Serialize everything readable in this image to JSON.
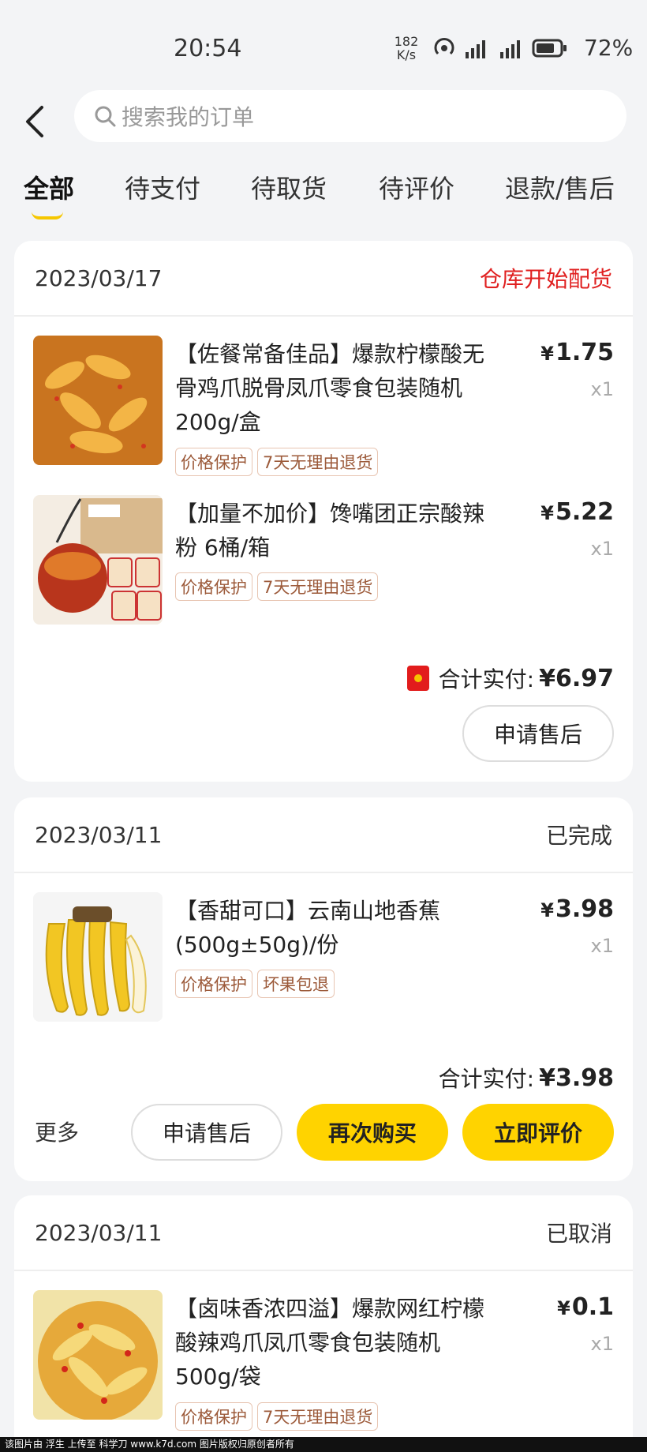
{
  "status_bar": {
    "time": "20:54",
    "speed_value": "182",
    "speed_unit": "K/s",
    "battery": "72%"
  },
  "search": {
    "placeholder": "搜索我的订单"
  },
  "tabs": [
    {
      "label": "全部",
      "active": true
    },
    {
      "label": "待支付"
    },
    {
      "label": "待取货"
    },
    {
      "label": "待评价"
    },
    {
      "label": "退款/售后"
    }
  ],
  "orders": [
    {
      "date": "2023/03/17",
      "status": "仓库开始配货",
      "status_color": "#e02020",
      "items": [
        {
          "title": "【佐餐常备佳品】爆款柠檬酸无骨鸡爪脱骨凤爪零食包装随机200g/盒",
          "price": "1.75",
          "qty": "x1",
          "tags": [
            "价格保护",
            "7天无理由退货"
          ]
        },
        {
          "title": "【加量不加价】馋嘴团正宗酸辣粉 6桶/箱",
          "price": "5.22",
          "qty": "x1",
          "tags": [
            "价格保护",
            "7天无理由退货"
          ]
        }
      ],
      "total_label": "合计实付:",
      "total": "¥6.97",
      "buttons": [
        "申请售后"
      ]
    },
    {
      "date": "2023/03/11",
      "status": "已完成",
      "items": [
        {
          "title": "【香甜可口】云南山地香蕉(500g±50g)/份",
          "price": "3.98",
          "qty": "x1",
          "tags": [
            "价格保护",
            "坏果包退"
          ]
        }
      ],
      "total_label": "合计实付:",
      "total": "¥3.98",
      "more": "更多",
      "buttons": [
        "申请售后",
        "再次购买",
        "立即评价"
      ]
    },
    {
      "date": "2023/03/11",
      "status": "已取消",
      "items": [
        {
          "title": "【卤味香浓四溢】爆款网红柠檬酸辣鸡爪凤爪零食包装随机500g/袋",
          "price": "0.1",
          "qty": "x1",
          "tags": [
            "价格保护",
            "7天无理由退货"
          ]
        }
      ]
    }
  ],
  "currency_symbol": "¥",
  "colors": {
    "accent": "#ffd300",
    "status_red": "#e02020",
    "tag_text": "#9c5a3a"
  },
  "footer": "该图片由 浮生 上传至 科学刀 www.k7d.com 图片版权归原创者所有"
}
